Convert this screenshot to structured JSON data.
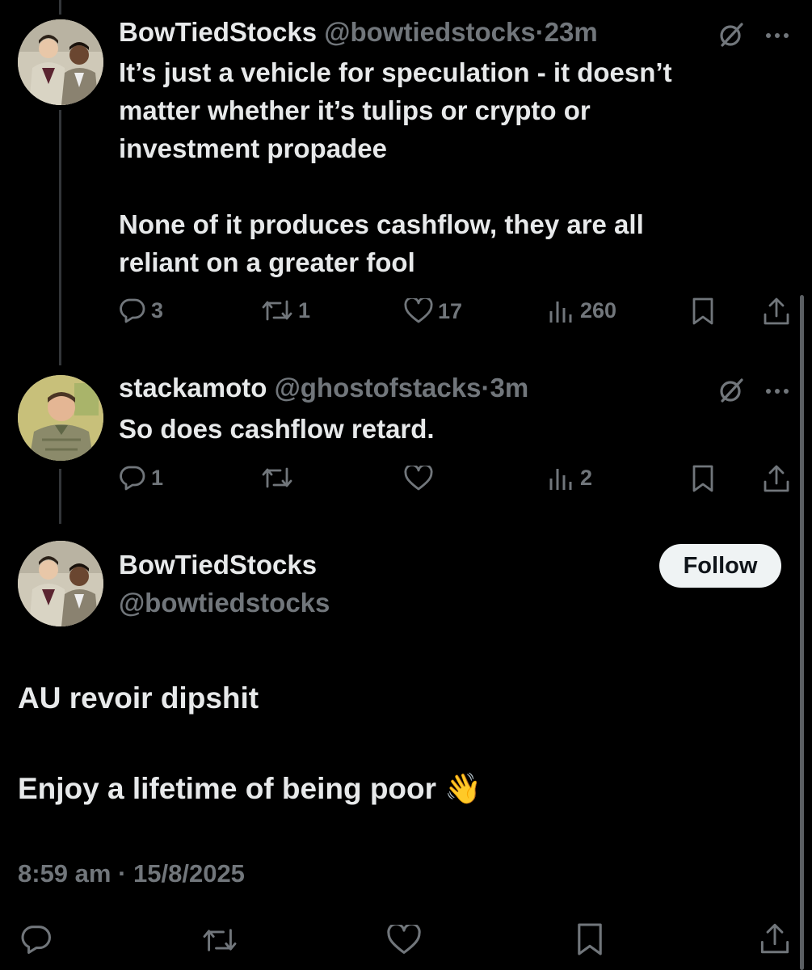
{
  "colors": {
    "background": "#000000",
    "text_primary": "#e7e9ea",
    "text_muted": "#71767b",
    "thread_line": "#333639",
    "follow_bg": "#eff3f4"
  },
  "tweet1": {
    "display_name": "BowTiedStocks",
    "handle": "@bowtiedstocks",
    "separator": "·",
    "time": "23m",
    "text": "It’s just a vehicle for speculation - it doesn’t\nmatter whether it’s tulips or crypto or\ninvestment propadee\n\nNone of it produces cashflow, they are all\nreliant on a greater fool",
    "replies": "3",
    "reposts": "1",
    "likes": "17",
    "views": "260",
    "icons": [
      "grok-icon",
      "more-icon",
      "reply-icon",
      "repost-icon",
      "like-icon",
      "views-icon",
      "bookmark-icon",
      "share-icon"
    ]
  },
  "tweet2": {
    "display_name": "stackamoto",
    "handle": "@ghostofstacks",
    "separator": "·",
    "time": "3m",
    "text": "So does cashflow retard.",
    "replies": "1",
    "views": "2"
  },
  "main_tweet": {
    "display_name": "BowTiedStocks",
    "handle": "@bowtiedstocks",
    "follow_label": "Follow",
    "line1": "AU revoir dipshit",
    "line2": "Enjoy a lifetime of being poor",
    "emoji": "👋",
    "timestamp": "8:59 am · 15/8/2025"
  }
}
